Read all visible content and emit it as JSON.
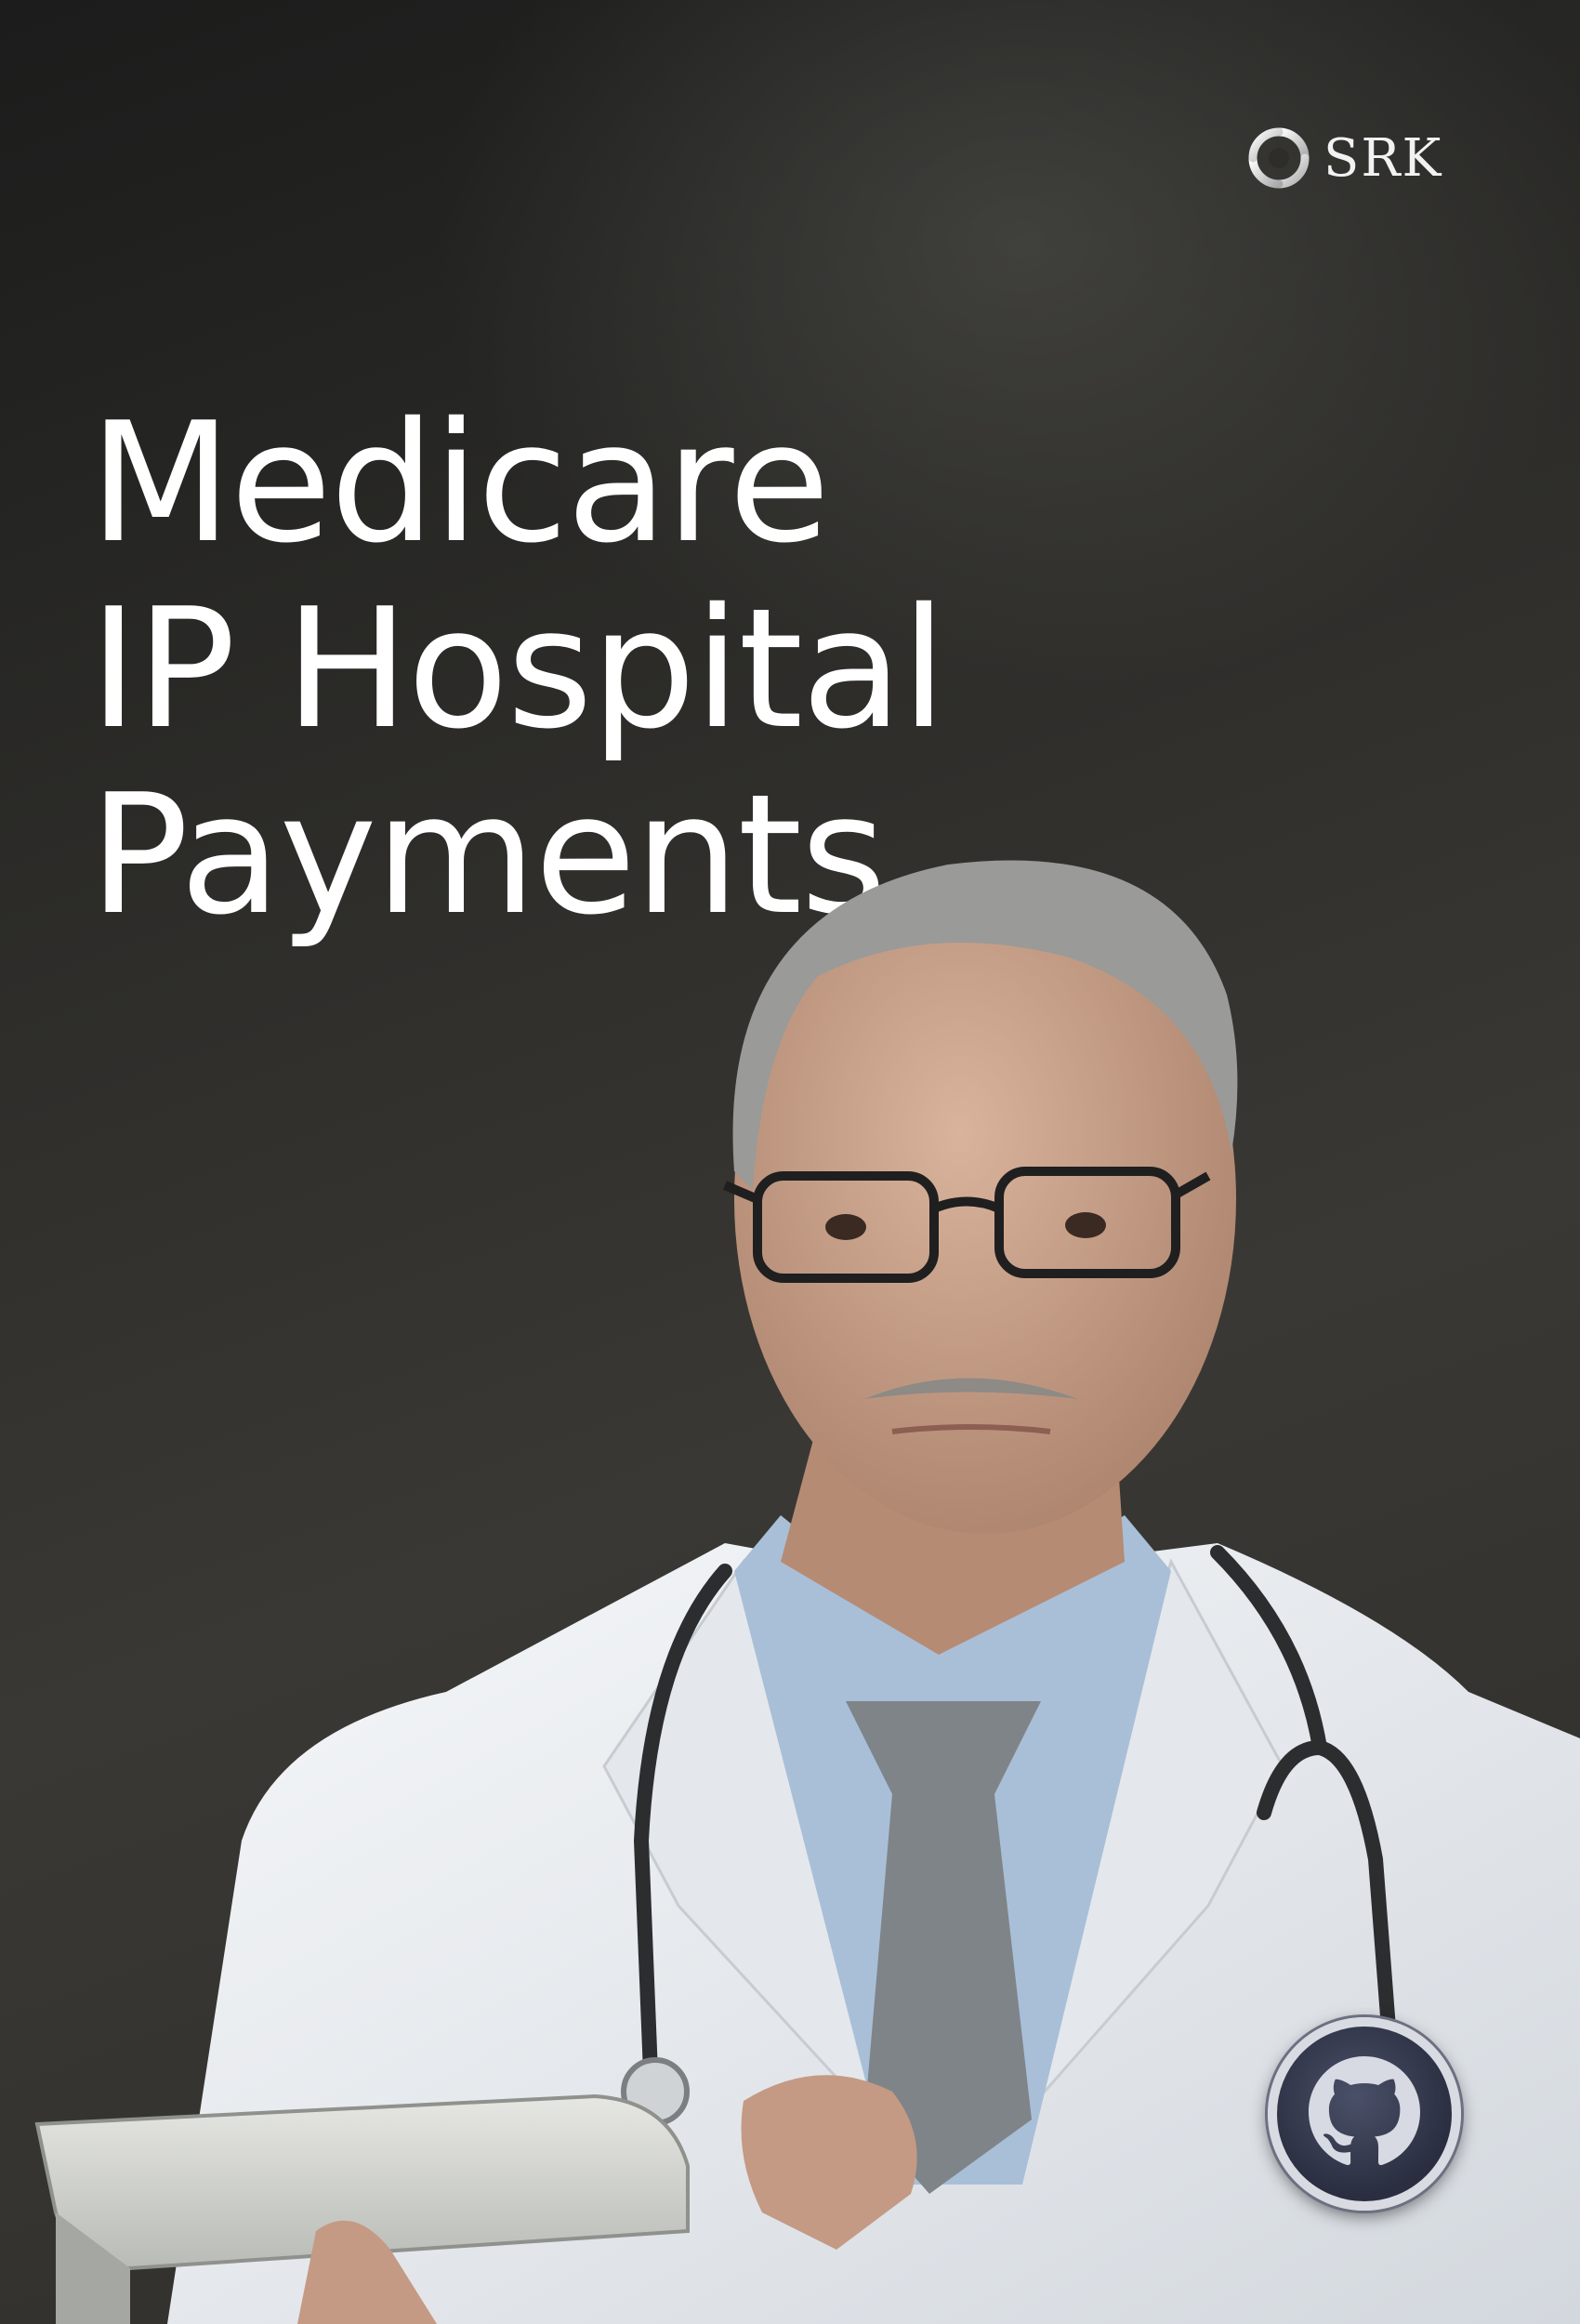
{
  "brand": {
    "logo_text": "SRK",
    "icon": "srk-swirl-logo-icon"
  },
  "title": {
    "line1": "Medicare",
    "line2": "IP Hospital",
    "line3": "Payments"
  },
  "badge": {
    "icon": "github-icon"
  },
  "colors": {
    "background": "#2e2d2a",
    "title": "#ffffff",
    "coat": "#eef1f4",
    "shirt": "#a9bfd8",
    "tie": "#7f8488"
  }
}
